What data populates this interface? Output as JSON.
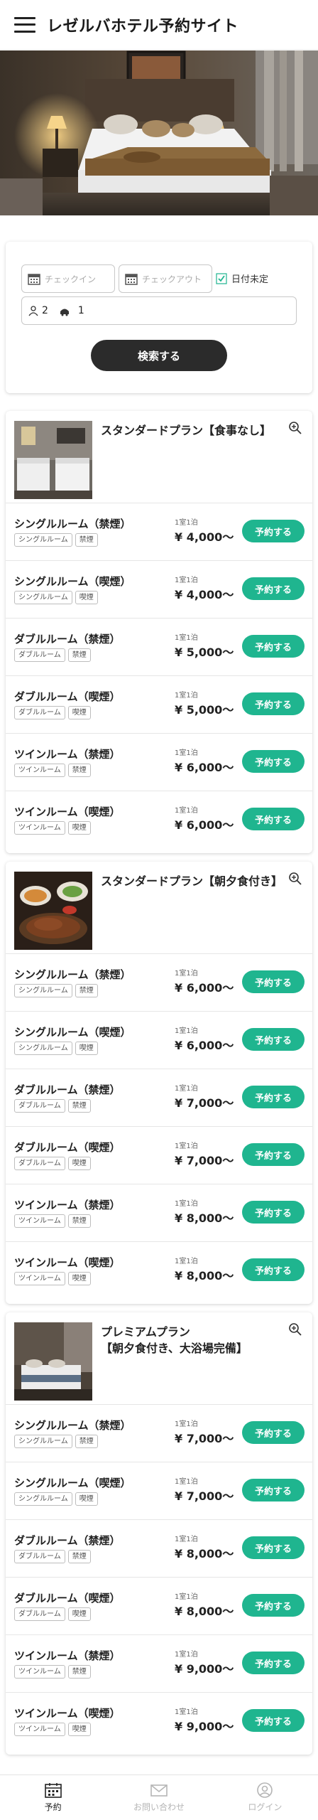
{
  "header": {
    "title": "レゼルバホテル予約サイト"
  },
  "search": {
    "checkin_placeholder": "チェックイン",
    "checkout_placeholder": "チェックアウト",
    "date_undecided": "日付未定",
    "adults": "2",
    "children": "1",
    "search_button": "検索する"
  },
  "plans": [
    {
      "title": "スタンダードプラン【食事なし】",
      "rooms": [
        {
          "name": "シングルルーム（禁煙）",
          "tags": [
            "シングルルーム",
            "禁煙"
          ],
          "per": "1室1泊",
          "price": "¥ 4,000〜",
          "button": "予約する"
        },
        {
          "name": "シングルルーム（喫煙）",
          "tags": [
            "シングルルーム",
            "喫煙"
          ],
          "per": "1室1泊",
          "price": "¥ 4,000〜",
          "button": "予約する"
        },
        {
          "name": "ダブルルーム（禁煙）",
          "tags": [
            "ダブルルーム",
            "禁煙"
          ],
          "per": "1室1泊",
          "price": "¥ 5,000〜",
          "button": "予約する"
        },
        {
          "name": "ダブルルーム（喫煙）",
          "tags": [
            "ダブルルーム",
            "喫煙"
          ],
          "per": "1室1泊",
          "price": "¥ 5,000〜",
          "button": "予約する"
        },
        {
          "name": "ツインルーム（禁煙）",
          "tags": [
            "ツインルーム",
            "禁煙"
          ],
          "per": "1室1泊",
          "price": "¥ 6,000〜",
          "button": "予約する"
        },
        {
          "name": "ツインルーム（喫煙）",
          "tags": [
            "ツインルーム",
            "喫煙"
          ],
          "per": "1室1泊",
          "price": "¥ 6,000〜",
          "button": "予約する"
        }
      ]
    },
    {
      "title": "スタンダードプラン【朝夕食付き】",
      "rooms": [
        {
          "name": "シングルルーム（禁煙）",
          "tags": [
            "シングルルーム",
            "禁煙"
          ],
          "per": "1室1泊",
          "price": "¥ 6,000〜",
          "button": "予約する"
        },
        {
          "name": "シングルルーム（喫煙）",
          "tags": [
            "シングルルーム",
            "喫煙"
          ],
          "per": "1室1泊",
          "price": "¥ 6,000〜",
          "button": "予約する"
        },
        {
          "name": "ダブルルーム（禁煙）",
          "tags": [
            "ダブルルーム",
            "禁煙"
          ],
          "per": "1室1泊",
          "price": "¥ 7,000〜",
          "button": "予約する"
        },
        {
          "name": "ダブルルーム（喫煙）",
          "tags": [
            "ダブルルーム",
            "喫煙"
          ],
          "per": "1室1泊",
          "price": "¥ 7,000〜",
          "button": "予約する"
        },
        {
          "name": "ツインルーム（禁煙）",
          "tags": [
            "ツインルーム",
            "禁煙"
          ],
          "per": "1室1泊",
          "price": "¥ 8,000〜",
          "button": "予約する"
        },
        {
          "name": "ツインルーム（喫煙）",
          "tags": [
            "ツインルーム",
            "喫煙"
          ],
          "per": "1室1泊",
          "price": "¥ 8,000〜",
          "button": "予約する"
        }
      ]
    },
    {
      "title": "プレミアムプラン\n【朝夕食付き、大浴場完備】",
      "rooms": [
        {
          "name": "シングルルーム（禁煙）",
          "tags": [
            "シングルルーム",
            "禁煙"
          ],
          "per": "1室1泊",
          "price": "¥ 7,000〜",
          "button": "予約する"
        },
        {
          "name": "シングルルーム（喫煙）",
          "tags": [
            "シングルルーム",
            "喫煙"
          ],
          "per": "1室1泊",
          "price": "¥ 7,000〜",
          "button": "予約する"
        },
        {
          "name": "ダブルルーム（禁煙）",
          "tags": [
            "ダブルルーム",
            "禁煙"
          ],
          "per": "1室1泊",
          "price": "¥ 8,000〜",
          "button": "予約する"
        },
        {
          "name": "ダブルルーム（喫煙）",
          "tags": [
            "ダブルルーム",
            "喫煙"
          ],
          "per": "1室1泊",
          "price": "¥ 8,000〜",
          "button": "予約する"
        },
        {
          "name": "ツインルーム（禁煙）",
          "tags": [
            "ツインルーム",
            "禁煙"
          ],
          "per": "1室1泊",
          "price": "¥ 9,000〜",
          "button": "予約する"
        },
        {
          "name": "ツインルーム（喫煙）",
          "tags": [
            "ツインルーム",
            "喫煙"
          ],
          "per": "1室1泊",
          "price": "¥ 9,000〜",
          "button": "予約する"
        }
      ]
    }
  ],
  "nav": {
    "items": [
      {
        "label": "予約",
        "icon": "calendar-icon",
        "active": true
      },
      {
        "label": "お問い合わせ",
        "icon": "mail-icon",
        "active": false
      },
      {
        "label": "ログイン",
        "icon": "user-icon",
        "active": false
      }
    ]
  },
  "colors": {
    "accent": "#1fb58f",
    "search_button": "#2b2b2b"
  }
}
